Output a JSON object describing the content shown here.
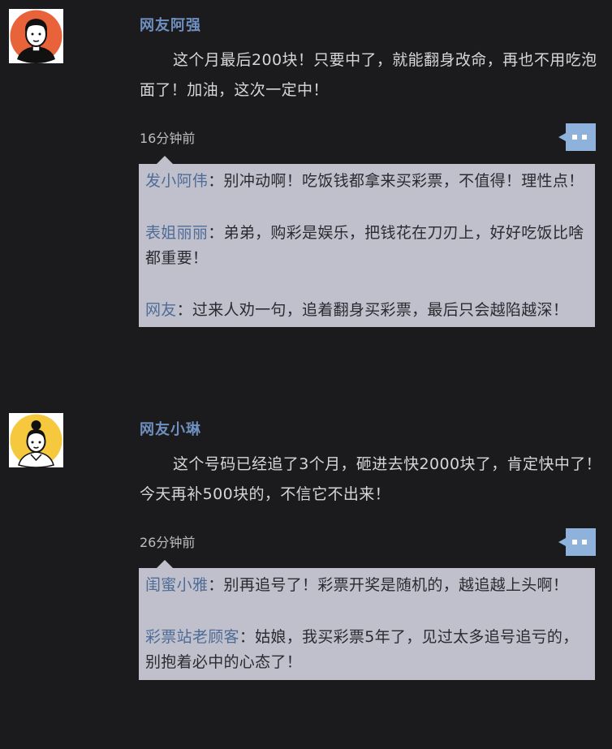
{
  "posts": [
    {
      "username": "网友阿强",
      "content": "这个月最后200块！只要中了，就能翻身改命，再也不用吃泡面了！加油，这次一定中！",
      "time": "16分钟前",
      "avatar": {
        "icon": "man-avatar-icon",
        "bg": "#e8623a"
      },
      "replies": [
        {
          "name": "发小阿伟",
          "text": "别冲动啊！吃饭钱都拿来买彩票，不值得！理性点！"
        },
        {
          "name": "表姐丽丽",
          "text": "弟弟，购彩是娱乐，把钱花在刀刃上，好好吃饭比啥都重要！"
        },
        {
          "name": "网友",
          "text": "过来人劝一句，追着翻身买彩票，最后只会越陷越深！"
        }
      ]
    },
    {
      "username": "网友小琳",
      "content": "这个号码已经追了3个月，砸进去快2000块了，肯定快中了！今天再补500块的，不信它不出来！",
      "time": "26分钟前",
      "avatar": {
        "icon": "woman-avatar-icon",
        "bg": "#f6c83e"
      },
      "replies": [
        {
          "name": "闺蜜小雅",
          "text": "别再追号了！彩票开奖是随机的，越追越上头啊！"
        },
        {
          "name": "彩票站老顾客",
          "text": "姑娘，我买彩票5年了，见过太多追号追亏的，别抱着必中的心态了！"
        }
      ]
    }
  ],
  "colors": {
    "background": "#1b1b1d",
    "username": "#6e8fbf",
    "reply_box": "#c0c0cc",
    "reply_name": "#4e6c96",
    "comment_icon": "#8fb2dc"
  }
}
